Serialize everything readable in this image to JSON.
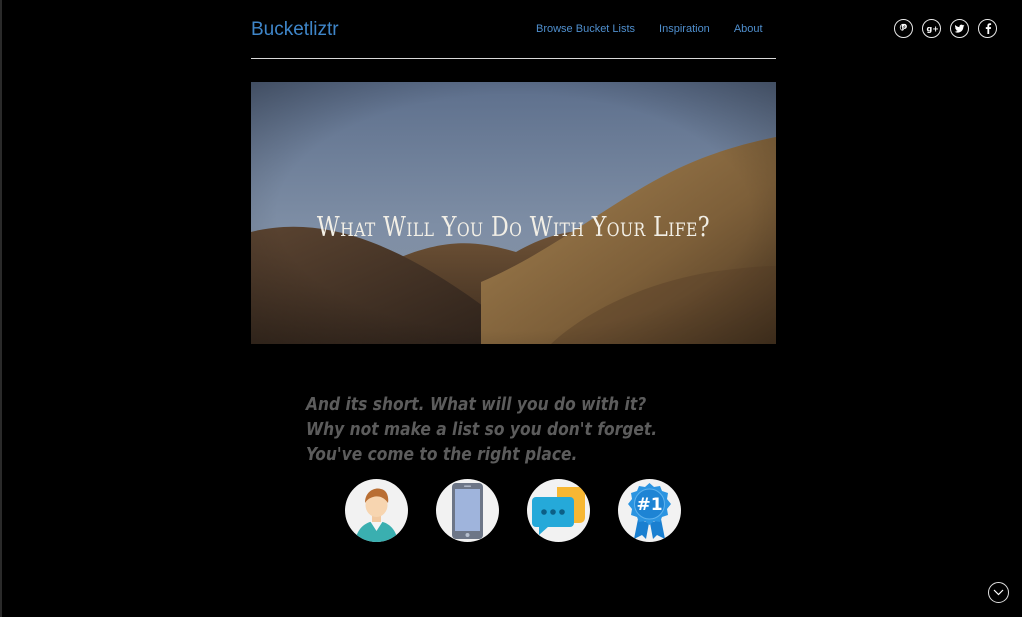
{
  "brand": "Bucketliztr",
  "nav": {
    "items": [
      {
        "label": "Browse Bucket Lists"
      },
      {
        "label": "Inspiration"
      },
      {
        "label": "About"
      }
    ]
  },
  "social": [
    "pinterest-icon",
    "google-plus-icon",
    "twitter-icon",
    "facebook-icon"
  ],
  "hero": {
    "title": "What Will You Do With Your Life?"
  },
  "tagline": "And its short. What will you do with it? Why not make a list so you don't forget. You've come to the right place.",
  "features": [
    {
      "icon": "person-icon"
    },
    {
      "icon": "tablet-icon"
    },
    {
      "icon": "chat-bubbles-icon"
    },
    {
      "icon": "number-one-badge-icon",
      "label": "#1"
    }
  ],
  "colors": {
    "brand": "#3f86c9",
    "background": "#000000",
    "tagline": "#5c5c5c"
  }
}
